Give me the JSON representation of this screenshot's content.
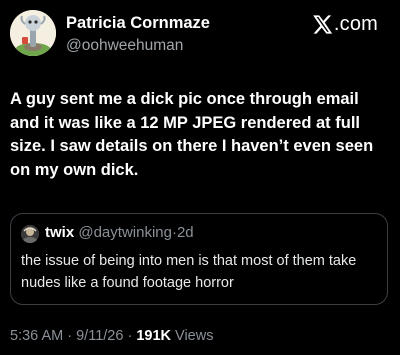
{
  "author": {
    "display_name": "Patricia Cornmaze",
    "handle": "@oohweehuman"
  },
  "brand": {
    "logo_icon": "x-logo-icon",
    "text": ".com"
  },
  "tweet": {
    "text": "A guy sent me a dick pic once through email and it was like a 12 MP JPEG rendered at full size. I saw details on there I haven’t even seen on my own dick."
  },
  "quote": {
    "avatar_icon": "avatar-icon",
    "display_name": "twix",
    "handle": "@daytwinking",
    "separator": "·",
    "age": "2d",
    "text": "the issue of being into men is that most of them take nudes like a found footage horror"
  },
  "meta": {
    "time": "5:36 AM",
    "separator": "·",
    "date": "9/11/26",
    "views_count": "191K",
    "views_label": "Views"
  },
  "colors": {
    "background": "#000000",
    "primary_text": "#ffffff",
    "secondary_text": "#8b9197",
    "border": "#3a3f44"
  }
}
